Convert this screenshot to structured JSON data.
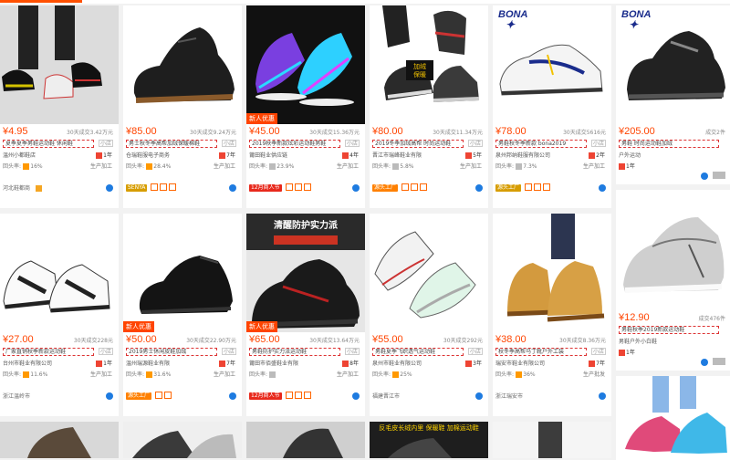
{
  "cards": [
    {
      "price": "¥4.95",
      "sales": "30天成交3.42万元",
      "title": "夏季夏季男鞋运动鞋 休闲鞋",
      "title_tag": "小店",
      "shop": "温州小都鞋店",
      "years": "1年",
      "rating": "16%",
      "rating_label": "回头率:",
      "label2": "生产加工",
      "loc": "河北鞋都商"
    },
    {
      "price": "¥85.00",
      "sales": "30天成交9.24万元",
      "title": "男士秋冬季高帮加绒保暖棉鞋",
      "title_tag": "小店",
      "shop": "仓瑞鞋服电子商务",
      "years": "7年",
      "rating": "28.4%",
      "rating_label": "回头率:",
      "label2": "生产加工",
      "badge": "SENYA",
      "loc": ""
    },
    {
      "price": "¥45.00",
      "sales": "30天成交15.36万元",
      "title": "2019秋季新款炫彩运动鞋男鞋",
      "title_tag": "小店",
      "shop": "莆田鞋业供应链",
      "years": "4年",
      "rating": "23.9%",
      "rating_label": "回头率:",
      "label2": "生产加工",
      "corner": "新人优惠",
      "badge": "12月商人节",
      "loc": ""
    },
    {
      "price": "¥80.00",
      "sales": "30天成交11.34万元",
      "title": "2019冬季加绒高帮 时尚运动鞋",
      "title_tag": "小店",
      "shop": "晋江市瑞峰鞋业有限",
      "years": "5年",
      "rating": "5.8%",
      "rating_label": "回头率:",
      "label2": "生产加工",
      "badge": "源头工厂",
      "loc": ""
    },
    {
      "price": "¥78.00",
      "sales": "30天成交5616元",
      "title": "男鞋秋冬季新款 bona2019",
      "title_tag": "小店",
      "shop": "泉州邦纳鞋服有限公司",
      "years": "2年",
      "rating": "7.3%",
      "rating_label": "回头率:",
      "label2": "生产加工",
      "badge": "源头工厂",
      "logo": "BONA",
      "loc": ""
    },
    {
      "price": "¥205.00",
      "sales": "成交2件",
      "title": "男鞋 时尚运动鞋加绒",
      "title_tag": "",
      "shop": "户外运动",
      "years": "1年",
      "rating": "",
      "rating_label": "",
      "label2": "",
      "logo": "BONA",
      "loc": ""
    },
    {
      "price": "¥27.00",
      "sales": "30天成交228元",
      "title": "厂家直销秋季新款运动鞋",
      "title_tag": "小店",
      "shop": "台州市鞋业有限公司",
      "years": "1年",
      "rating": "11.6%",
      "rating_label": "回头率:",
      "label2": "生产加工",
      "loc": "浙江温岭市"
    },
    {
      "price": "¥50.00",
      "sales": "30天成交22.90万元",
      "title": "2019男士休闲皮鞋加绒",
      "title_tag": "小店",
      "shop": "温州瑞源鞋业有限",
      "years": "7年",
      "rating": "31.6%",
      "rating_label": "回头率:",
      "label2": "生产加工",
      "corner": "新人优惠",
      "badge": "源头工厂",
      "loc": ""
    },
    {
      "price": "¥65.00",
      "sales": "30天成交13.64万元",
      "title": "男鞋防护实力派运动鞋",
      "title_tag": "小店",
      "shop": "莆田市佰盛鞋业有限",
      "years": "8年",
      "rating": "",
      "rating_label": "回头率:",
      "label2": "生产加工",
      "corner": "新人优惠",
      "badge": "12月商人节",
      "img_text": "清醒防护实力派",
      "loc": ""
    },
    {
      "price": "¥55.00",
      "sales": "30天成交292元",
      "title": "男鞋夏季飞织透气运动鞋",
      "title_tag": "小店",
      "shop": "泉州市鞋业有限公司",
      "years": "3年",
      "rating": "25%",
      "rating_label": "回头率:",
      "label2": "",
      "loc": "福建晋江市"
    },
    {
      "price": "¥38.00",
      "sales": "30天成交8.36万元",
      "title": "秋冬季高帮马丁靴户外工装",
      "title_tag": "小店",
      "shop": "瑞安市鞋业有限公司",
      "years": "7年",
      "rating": "36%",
      "rating_label": "回头率:",
      "label2": "生产批发",
      "loc": "浙江瑞安市"
    },
    {
      "price": "¥12.90",
      "sales": "成交476件",
      "title": "男鞋秋季2019新款运动鞋",
      "title_tag": "",
      "shop": "男鞋户外小白鞋",
      "years": "1年",
      "rating": "",
      "rating_label": "",
      "label2": "",
      "loc": ""
    }
  ],
  "row3_text": "反毛皮长绒内里 保暖鞋 加棉运动鞋"
}
